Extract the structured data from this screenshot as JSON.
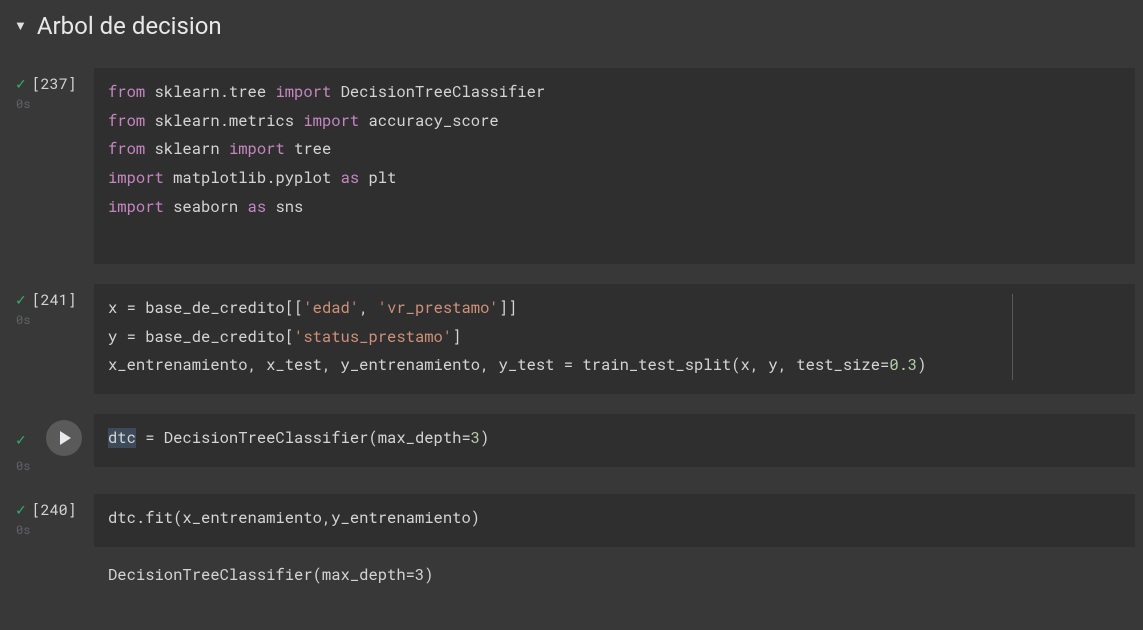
{
  "section": {
    "title": "Arbol de decision"
  },
  "cells": [
    {
      "index_label": "[237]",
      "exec_time": "0s",
      "status": "ok",
      "code_tokens": [
        [
          {
            "t": "from ",
            "c": "kw"
          },
          {
            "t": "sklearn.tree ",
            "c": "plain"
          },
          {
            "t": "import ",
            "c": "kw"
          },
          {
            "t": "DecisionTreeClassifier",
            "c": "plain"
          }
        ],
        [
          {
            "t": "from ",
            "c": "kw"
          },
          {
            "t": "sklearn.metrics ",
            "c": "plain"
          },
          {
            "t": "import ",
            "c": "kw"
          },
          {
            "t": "accuracy_score",
            "c": "plain"
          }
        ],
        [
          {
            "t": "from ",
            "c": "kw"
          },
          {
            "t": "sklearn ",
            "c": "plain"
          },
          {
            "t": "import ",
            "c": "kw"
          },
          {
            "t": "tree",
            "c": "plain"
          }
        ],
        [
          {
            "t": "import ",
            "c": "kw"
          },
          {
            "t": "matplotlib.pyplot ",
            "c": "plain"
          },
          {
            "t": "as ",
            "c": "kw"
          },
          {
            "t": "plt",
            "c": "plain"
          }
        ],
        [
          {
            "t": "import ",
            "c": "kw"
          },
          {
            "t": "seaborn ",
            "c": "plain"
          },
          {
            "t": "as ",
            "c": "kw"
          },
          {
            "t": "sns",
            "c": "plain"
          }
        ],
        [
          {
            "t": " ",
            "c": "plain"
          }
        ]
      ]
    },
    {
      "index_label": "[241]",
      "exec_time": "0s",
      "status": "ok",
      "show_vline": true,
      "code_tokens": [
        [
          {
            "t": "x = base_de_credito[[",
            "c": "plain"
          },
          {
            "t": "'edad'",
            "c": "str"
          },
          {
            "t": ", ",
            "c": "plain"
          },
          {
            "t": "'vr_prestamo'",
            "c": "str"
          },
          {
            "t": "]]",
            "c": "plain"
          }
        ],
        [
          {
            "t": "y = base_de_credito[",
            "c": "plain"
          },
          {
            "t": "'status_prestamo'",
            "c": "str"
          },
          {
            "t": "]",
            "c": "plain"
          }
        ],
        [
          {
            "t": "x_entrenamiento, x_test, y_entrenamiento, y_test = train_test_split(x, y, test_size=",
            "c": "plain"
          },
          {
            "t": "0.3",
            "c": "num"
          },
          {
            "t": ")",
            "c": "plain"
          }
        ]
      ]
    },
    {
      "index_label": "",
      "exec_time": "0s",
      "status": "ok",
      "focused": true,
      "code_tokens": [
        [
          {
            "t": "dtc",
            "c": "plain",
            "hl": true
          },
          {
            "t": " = DecisionTreeClassifier(max_depth=",
            "c": "plain"
          },
          {
            "t": "3",
            "c": "num"
          },
          {
            "t": ")",
            "c": "plain"
          }
        ]
      ]
    },
    {
      "index_label": "[240]",
      "exec_time": "0s",
      "status": "ok",
      "code_tokens": [
        [
          {
            "t": "dtc.fit(x_entrenamiento,y_entrenamiento)",
            "c": "plain"
          }
        ]
      ],
      "output": "DecisionTreeClassifier(max_depth=3)"
    }
  ]
}
